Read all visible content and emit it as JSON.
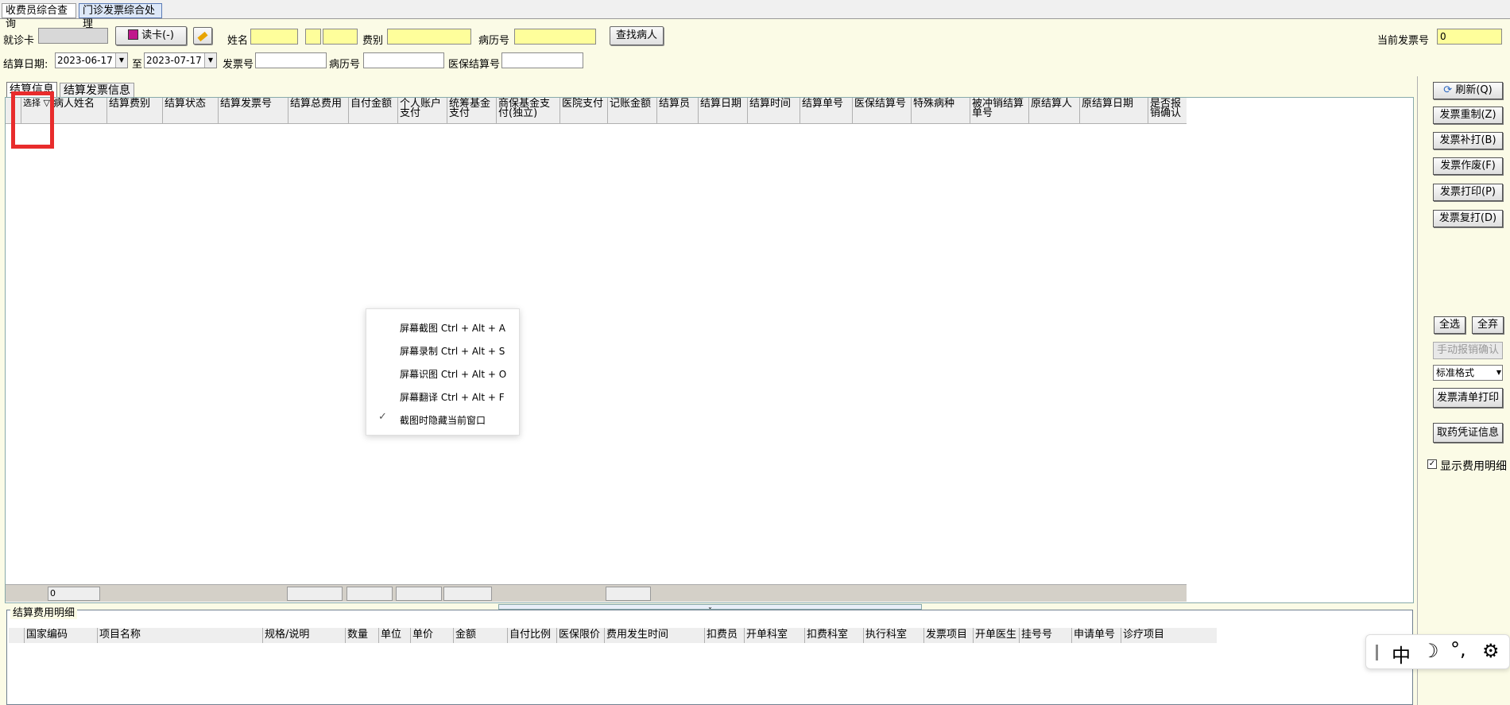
{
  "tabs": [
    {
      "label": "收费员综合查询"
    },
    {
      "label": "门诊发票综合处理"
    }
  ],
  "search": {
    "card_label": "就诊卡",
    "card_value": "",
    "read_card_btn": "读卡(-)",
    "name_label": "姓名",
    "name_value": "",
    "fee_label": "费别",
    "fee_value": "",
    "record_label": "病历号",
    "record_value": "",
    "find_btn": "查找病人",
    "current_invoice_label": "当前发票号",
    "current_invoice_value": "0",
    "date_label": "结算日期:",
    "date_from": "2023-06-17",
    "date_to_label": "至",
    "date_to": "2023-07-17",
    "invoice_label": "发票号",
    "record2_label": "病历号",
    "insurance_no_label": "医保结算号"
  },
  "inner_tabs": [
    {
      "label": "结算信息"
    },
    {
      "label": "结算发票信息"
    }
  ],
  "settle_columns": [
    "选择",
    "病人姓名",
    "结算费别",
    "结算状态",
    "结算发票号",
    "结算总费用",
    "自付金额",
    "个人账户支付",
    "统筹基金支付",
    "商保基金支付(独立)",
    "医院支付",
    "记账金额",
    "结算员",
    "结算日期",
    "结算时间",
    "结算单号",
    "医保结算号",
    "特殊病种",
    "被冲销结算单号",
    "原结算人",
    "原结算日期",
    "是否报销确认"
  ],
  "settle_footer": {
    "count": "0"
  },
  "right_buttons": {
    "refresh": "刷新(Q)",
    "reset": "发票重制(Z)",
    "reprint_supp": "发票补打(B)",
    "void": "发票作废(F)",
    "print": "发票打印(P)",
    "reprint": "发票复打(D)",
    "select_all": "全选",
    "deselect_all": "全弃",
    "manual_confirm": "手动报销确认",
    "format_select": "标准格式",
    "list_print": "发票清单打印",
    "receipt_info": "取药凭证信息",
    "show_detail": "显示费用明细"
  },
  "detail": {
    "title": "结算费用明细",
    "columns": [
      "国家编码",
      "项目名称",
      "规格/说明",
      "数量",
      "单位",
      "单价",
      "金额",
      "自付比例",
      "医保限价",
      "费用发生时间",
      "扣费员",
      "开单科室",
      "扣费科室",
      "执行科室",
      "发票项目",
      "开单医生",
      "挂号号",
      "申请单号",
      "诊疗项目"
    ]
  },
  "context_menu": {
    "items": [
      "屏幕截图 Ctrl + Alt + A",
      "屏幕录制 Ctrl + Alt + S",
      "屏幕识图 Ctrl + Alt + O",
      "屏幕翻译 Ctrl + Alt + F"
    ],
    "checked_item": "截图时隐藏当前窗口"
  },
  "ime": {
    "lang": "中",
    "punct": "°,"
  }
}
